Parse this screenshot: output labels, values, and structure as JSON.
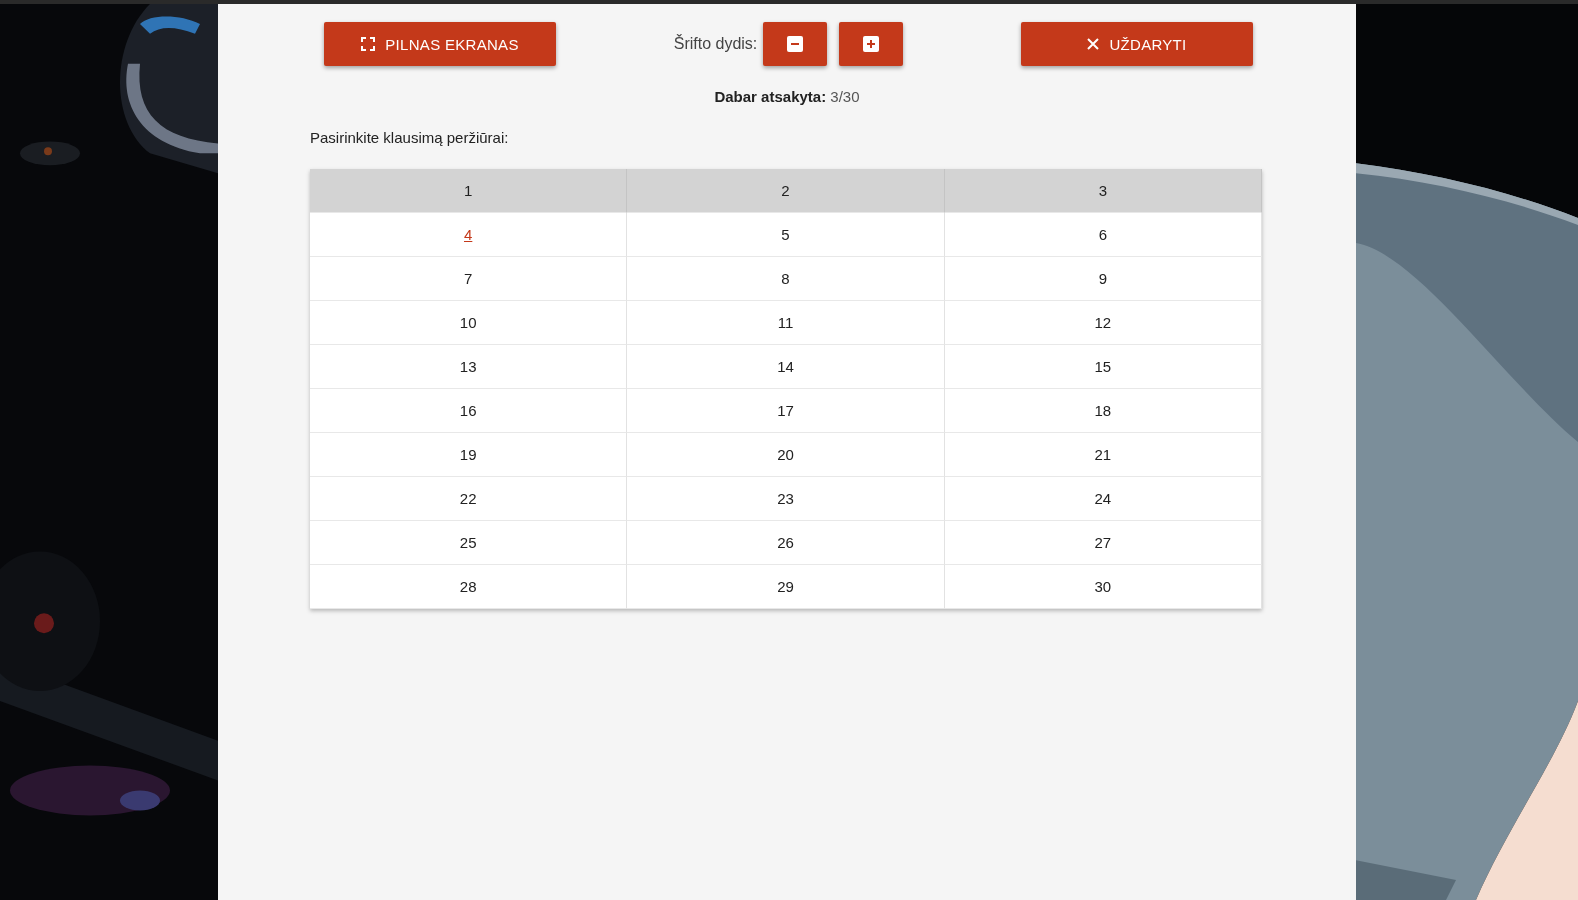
{
  "toolbar": {
    "fullscreen_button": "PILNAS EKRANAS",
    "font_size_label": "Šrifto dydis:",
    "close_button": "UŽDARYTI"
  },
  "progress": {
    "label": "Dabar atsakyta:",
    "value": "3/30"
  },
  "prompt": "Pasirinkite klausimą peržiūrai:",
  "questions": [
    {
      "label": "1",
      "answered": true,
      "selected": false
    },
    {
      "label": "2",
      "answered": true,
      "selected": false
    },
    {
      "label": "3",
      "answered": true,
      "selected": false
    },
    {
      "label": "4",
      "answered": false,
      "selected": true
    },
    {
      "label": "5",
      "answered": false,
      "selected": false
    },
    {
      "label": "6",
      "answered": false,
      "selected": false
    },
    {
      "label": "7",
      "answered": false,
      "selected": false
    },
    {
      "label": "8",
      "answered": false,
      "selected": false
    },
    {
      "label": "9",
      "answered": false,
      "selected": false
    },
    {
      "label": "10",
      "answered": false,
      "selected": false
    },
    {
      "label": "11",
      "answered": false,
      "selected": false
    },
    {
      "label": "12",
      "answered": false,
      "selected": false
    },
    {
      "label": "13",
      "answered": false,
      "selected": false
    },
    {
      "label": "14",
      "answered": false,
      "selected": false
    },
    {
      "label": "15",
      "answered": false,
      "selected": false
    },
    {
      "label": "16",
      "answered": false,
      "selected": false
    },
    {
      "label": "17",
      "answered": false,
      "selected": false
    },
    {
      "label": "18",
      "answered": false,
      "selected": false
    },
    {
      "label": "19",
      "answered": false,
      "selected": false
    },
    {
      "label": "20",
      "answered": false,
      "selected": false
    },
    {
      "label": "21",
      "answered": false,
      "selected": false
    },
    {
      "label": "22",
      "answered": false,
      "selected": false
    },
    {
      "label": "23",
      "answered": false,
      "selected": false
    },
    {
      "label": "24",
      "answered": false,
      "selected": false
    },
    {
      "label": "25",
      "answered": false,
      "selected": false
    },
    {
      "label": "26",
      "answered": false,
      "selected": false
    },
    {
      "label": "27",
      "answered": false,
      "selected": false
    },
    {
      "label": "28",
      "answered": false,
      "selected": false
    },
    {
      "label": "29",
      "answered": false,
      "selected": false
    },
    {
      "label": "30",
      "answered": false,
      "selected": false
    }
  ]
}
